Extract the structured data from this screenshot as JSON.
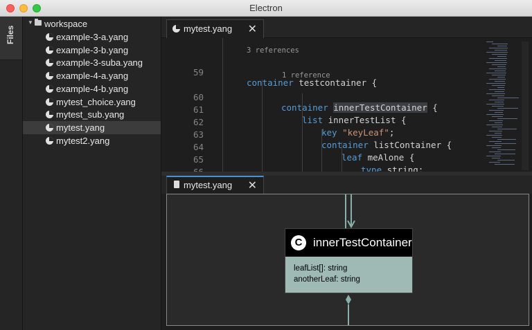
{
  "window": {
    "title": "Electron"
  },
  "sidebar": {
    "tab_label": "Files"
  },
  "tree": {
    "root": "workspace",
    "files": [
      "example-3-a.yang",
      "example-3-b.yang",
      "example-3-suba.yang",
      "example-4-a.yang",
      "example-4-b.yang",
      "mytest_choice.yang",
      "mytest_sub.yang",
      "mytest.yang",
      "mytest2.yang"
    ],
    "selected_index": 7
  },
  "editor": {
    "tab_label": "mytest.yang",
    "close_glyph": "✕",
    "codelens_1": "3 references",
    "codelens_2": "1 reference",
    "lines": {
      "l59": {
        "num": "59",
        "kw": "container",
        "rest": " testcontainer {"
      },
      "l60": {
        "num": "60",
        "kw": "container",
        "name": "innerTestContainer",
        "rest": " {"
      },
      "l61": {
        "num": "61",
        "kw": "list",
        "rest": " innerTestList {"
      },
      "l62": {
        "num": "62",
        "kw": "key",
        "str": "\"keyLeaf\"",
        "rest": ";"
      },
      "l63": {
        "num": "63",
        "kw": "container",
        "rest": " listContainer {"
      },
      "l64": {
        "num": "64",
        "kw": "leaf",
        "rest": " meAlone {"
      },
      "l65": {
        "num": "65",
        "kw": "type",
        "rest": " string;"
      },
      "l66": {
        "num": "66",
        "rest": "}"
      }
    }
  },
  "diagram": {
    "tab_label": "mytest.yang",
    "close_glyph": "✕",
    "class": {
      "stereotype": "C",
      "name": "innerTestContainer",
      "attributes": [
        "leafList[]: string",
        "anotherLeaf: string"
      ]
    },
    "colors": {
      "class_body": "#9fb9b5",
      "connector": "#8ab0ac"
    }
  }
}
